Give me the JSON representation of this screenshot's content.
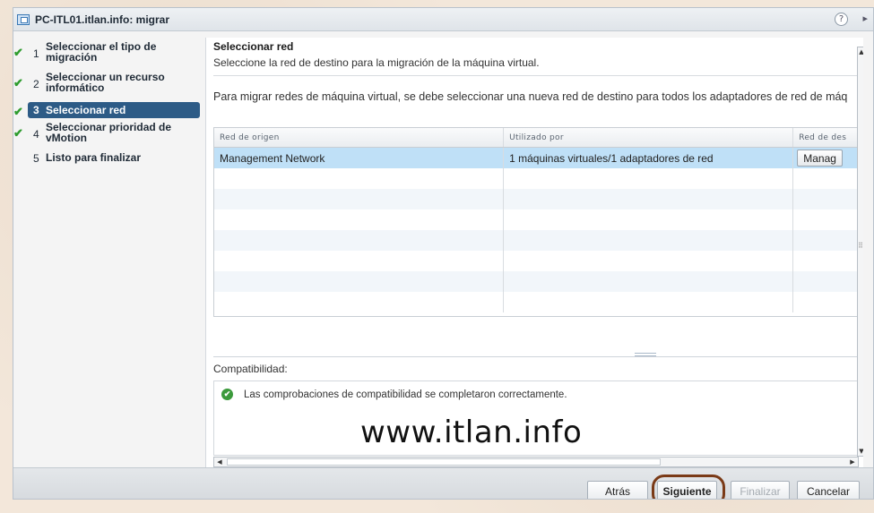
{
  "window": {
    "title": "PC-ITL01.itlan.info: migrar",
    "help_label": "?",
    "expand_glyph": "▸"
  },
  "nav": {
    "steps": [
      {
        "num": "1",
        "label": "Seleccionar el tipo de migración",
        "done": true
      },
      {
        "num": "2",
        "label": "Seleccionar un recurso informático",
        "done": true
      },
      {
        "num": "3",
        "label": "Seleccionar red",
        "done": true,
        "active": true
      },
      {
        "num": "4",
        "label": "Seleccionar prioridad de vMotion",
        "done": true
      },
      {
        "num": "5",
        "label": "Listo para finalizar",
        "done": false
      }
    ],
    "check_glyph": "✔"
  },
  "main": {
    "title": "Seleccionar red",
    "subtitle": "Seleccione la red de destino para la migración de la máquina virtual.",
    "intro": "Para migrar redes de máquina virtual, se debe seleccionar una nueva red de destino para todos los adaptadores de red de máq",
    "table": {
      "columns": [
        "Red de origen",
        "Utilizado por",
        "Red de des"
      ],
      "rows": [
        {
          "source": "Management Network",
          "used_by": "1 máquinas virtuales/1 adaptadores de red",
          "dest": "Manag"
        }
      ]
    },
    "compat": {
      "label": "Compatibilidad:",
      "message": "Las comprobaciones de compatibilidad se completaron correctamente."
    },
    "watermark": "www.itlan.info"
  },
  "footer": {
    "back": "Atrás",
    "next": "Siguiente",
    "finish": "Finalizar",
    "cancel": "Cancelar"
  },
  "colors": {
    "active_step": "#2d5b86",
    "selected_row": "#bfe0f7",
    "ok_green": "#3c9a3c",
    "highlight_ring": "#7a3a17"
  }
}
